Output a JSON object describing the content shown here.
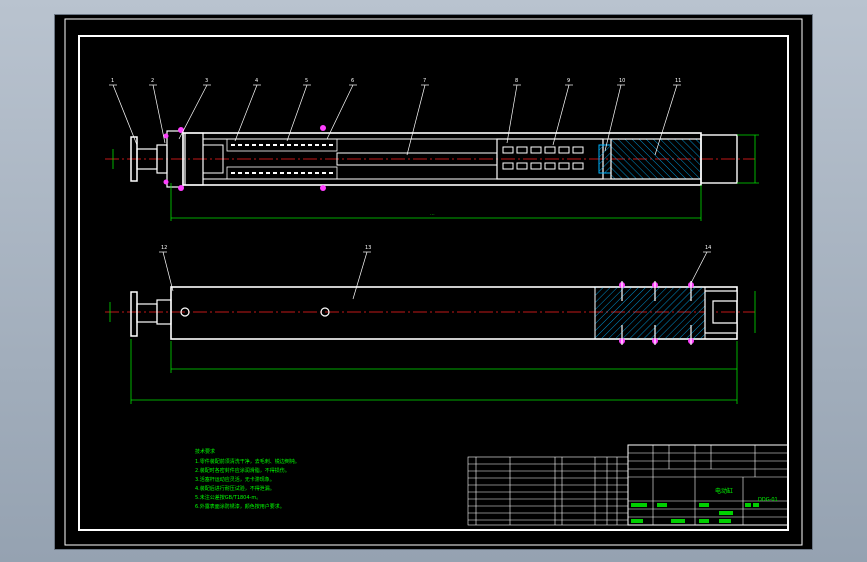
{
  "drawing": {
    "part_balloons": [
      "1",
      "2",
      "3",
      "4",
      "5",
      "6",
      "7",
      "8",
      "9",
      "10",
      "11",
      "12",
      "13",
      "14"
    ],
    "technical_requirements": {
      "title": "技术要求",
      "lines": [
        "1.零件装配前须清洗干净，去毛刺、锐边倒钝。",
        "2.装配时各密封件应涂润滑脂，不得损伤。",
        "3.活塞杆运动应灵活，无卡滞现象。",
        "4.装配后进行耐压试验，不得泄漏。",
        "5.未注公差按GB/T1804-m。",
        "6.外露表面涂防锈漆，颜色按用户要求。"
      ]
    },
    "title_block": {
      "drawing_name": "电动缸",
      "drawing_number": "DDG-01"
    }
  },
  "colors": {
    "outline": "#ffffff",
    "centerline": "#ff2020",
    "dimension": "#00e000",
    "leader": "#ffffff",
    "hatch": "#00c8ff",
    "bolt": "#ff40ff",
    "text": "#00ff00"
  }
}
